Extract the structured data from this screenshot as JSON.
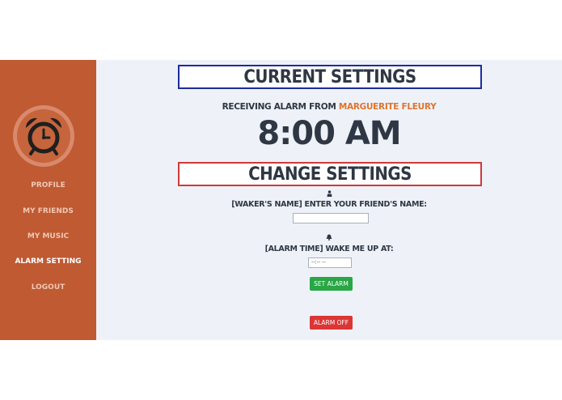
{
  "sidebar": {
    "logo_icon": "alarm-clock-icon",
    "items": [
      {
        "label": "PROFILE",
        "active": false
      },
      {
        "label": "MY FRIENDS",
        "active": false
      },
      {
        "label": "MY MUSIC",
        "active": false
      },
      {
        "label": "ALARM SETTING",
        "active": true
      },
      {
        "label": "LOGOUT",
        "active": false
      }
    ]
  },
  "current": {
    "heading": "CURRENT SETTINGS",
    "receiving_prefix": "RECEIVING ALARM FROM",
    "friend_name": "MARGUERITE FLEURY",
    "time": "8:00 AM"
  },
  "change": {
    "heading": "CHANGE SETTINGS",
    "waker_icon": "person-icon",
    "waker_label": "[WAKER'S NAME] ENTER YOUR FRIEND'S NAME:",
    "waker_value": "",
    "alarm_icon": "bell-icon",
    "alarm_label": "[ALARM TIME] WAKE ME UP AT:",
    "alarm_value": "--:-- --",
    "set_button": "SET ALARM",
    "off_button": "ALARM OFF"
  },
  "colors": {
    "sidebar": "#bf5a33",
    "accent": "#e0742f",
    "current_border": "#1d2c9c",
    "change_border": "#cf3939",
    "set_button": "#28a745",
    "off_button": "#dc3535"
  }
}
